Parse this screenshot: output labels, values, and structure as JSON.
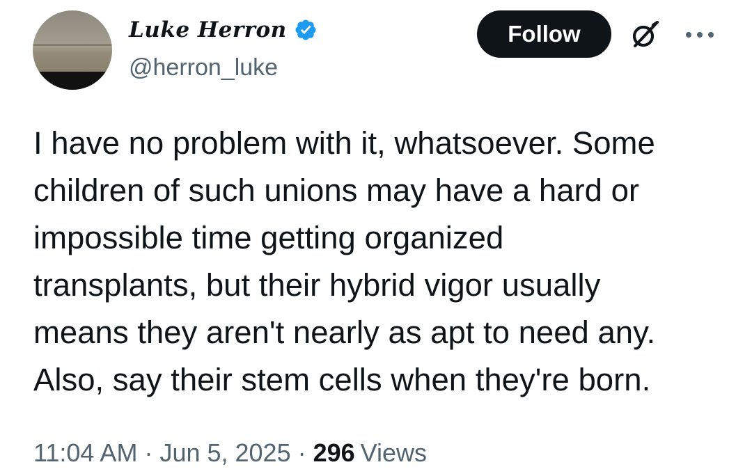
{
  "author": {
    "display_name": "Luke Herron",
    "handle": "@herron_luke",
    "verified": true
  },
  "actions": {
    "follow_label": "Follow",
    "grok_icon": "grok-icon",
    "more_icon": "more-horizontal-icon"
  },
  "tweet": {
    "text": "I have no problem with it, whatsoever. Some\nchildren of such unions may have a hard or\nimpossible time getting organized\ntransplants, but their hybrid vigor usually\nmeans they aren't nearly as apt to need any.\nAlso, say their stem cells when they're born."
  },
  "meta": {
    "time": "11:04 AM",
    "separator": "·",
    "date": "Jun 5, 2025",
    "views_count": "296",
    "views_label": "Views"
  },
  "colors": {
    "text_primary": "#0f1419",
    "text_secondary": "#536471",
    "verified_blue": "#1d9bf0",
    "follow_bg": "#0f1419"
  }
}
